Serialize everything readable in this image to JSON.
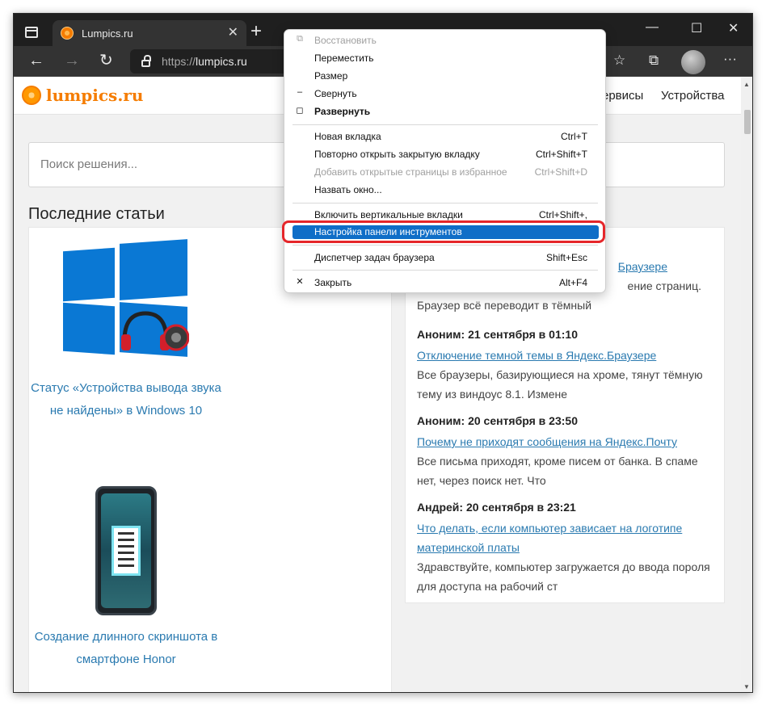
{
  "colors": {
    "accent": "#0f6ec7",
    "link": "#2a7ab0",
    "brand": "#f57c00",
    "highlight_ring": "#e5262a"
  },
  "tab": {
    "title": "Lumpics.ru",
    "close": "✕"
  },
  "new_tab": "+",
  "window_controls": {
    "minimize": "—",
    "maximize": "☐",
    "close": "✕"
  },
  "nav": {
    "back": "←",
    "forward": "→",
    "refresh": "↻"
  },
  "address": {
    "scheme": "https://",
    "host": "lumpics.ru"
  },
  "toolbar_icons": {
    "favorites": "☆",
    "collections": "⧉",
    "menu": "···"
  },
  "site": {
    "logo_text": "lumpics.ru",
    "nav_links": [
      "ервисы",
      "Устройства"
    ],
    "search_placeholder": "Поиск решения...",
    "section_title": "Последние статьи",
    "articles": [
      {
        "title": "Статус «Устройства вывода звука не найдены» в Windows 10"
      },
      {
        "title": "Создание длинного скриншота в смартфоне Honor"
      }
    ],
    "comments_partial": [
      {
        "link_tail": "Браузере",
        "text_tail": "ение страниц.",
        "text_line": "Браузер всё переводит в тёмный"
      }
    ],
    "comments": [
      {
        "author": "Аноним: 21 сентября в 01:10",
        "link": "Отключение темной темы в Яндекс.Браузере",
        "text": "Все браузеры, базирующиеся на хроме, тянут тёмную тему из виндоус 8.1. Измене"
      },
      {
        "author": "Аноним: 20 сентября в 23:50",
        "link": "Почему не приходят сообщения на Яндекс.Почту",
        "text": "Все письма приходят, кроме писем от банка. В спаме нет, через поиск нет. Что"
      },
      {
        "author": "Андрей: 20 сентября в 23:21",
        "link": "Что делать, если компьютер зависает на логотипе материнской платы",
        "text": "Здравствуйте, компьютер загружается до ввода пороля для доступа на рабочий ст"
      }
    ]
  },
  "context_menu": {
    "items": [
      {
        "label": "Восстановить",
        "shortcut": "",
        "glyph": "⧉",
        "state": "disabled"
      },
      {
        "label": "Переместить",
        "shortcut": "",
        "glyph": "",
        "state": "normal"
      },
      {
        "label": "Размер",
        "shortcut": "",
        "glyph": "",
        "state": "normal"
      },
      {
        "label": "Свернуть",
        "shortcut": "",
        "glyph": "–",
        "state": "normal"
      },
      {
        "label": "Развернуть",
        "shortcut": "",
        "glyph": "◻",
        "state": "bold"
      },
      {
        "label": "Новая вкладка",
        "shortcut": "Ctrl+T",
        "glyph": "",
        "state": "normal"
      },
      {
        "label": "Повторно открыть закрытую вкладку",
        "shortcut": "Ctrl+Shift+T",
        "glyph": "",
        "state": "normal"
      },
      {
        "label": "Добавить открытые страницы в избранное",
        "shortcut": "Ctrl+Shift+D",
        "glyph": "",
        "state": "disabled"
      },
      {
        "label": "Назвать окно...",
        "shortcut": "",
        "glyph": "",
        "state": "normal"
      },
      {
        "label": "Включить вертикальные вкладки",
        "shortcut": "Ctrl+Shift+,",
        "glyph": "",
        "state": "normal"
      },
      {
        "label": "Настройка панели инструментов",
        "shortcut": "",
        "glyph": "",
        "state": "selected"
      },
      {
        "label": "Диспетчер задач браузера",
        "shortcut": "Shift+Esc",
        "glyph": "",
        "state": "normal"
      },
      {
        "label": "Закрыть",
        "shortcut": "Alt+F4",
        "glyph": "✕",
        "state": "normal"
      }
    ]
  }
}
